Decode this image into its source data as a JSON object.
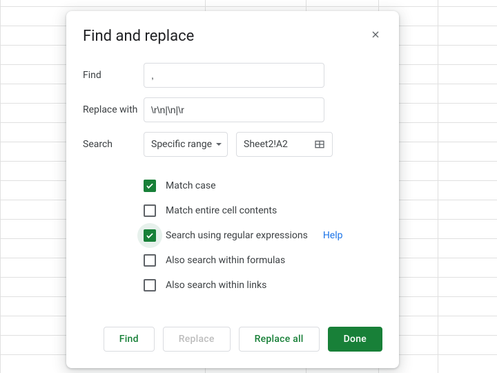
{
  "dialog": {
    "title": "Find and replace",
    "labels": {
      "find": "Find",
      "replace_with": "Replace with",
      "search": "Search"
    },
    "find_value": ",",
    "replace_value": "\\r\\n|\\n|\\r",
    "search_scope": "Specific range",
    "range_value": "Sheet2!A2",
    "checks": {
      "match_case": {
        "label": "Match case",
        "checked": true
      },
      "match_entire": {
        "label": "Match entire cell contents",
        "checked": false
      },
      "regex": {
        "label": "Search using regular expressions",
        "checked": true,
        "help": "Help"
      },
      "formulas": {
        "label": "Also search within formulas",
        "checked": false
      },
      "links": {
        "label": "Also search within links",
        "checked": false
      }
    },
    "buttons": {
      "find": "Find",
      "replace": "Replace",
      "replace_all": "Replace all",
      "done": "Done"
    }
  },
  "colors": {
    "primary": "#188038",
    "link": "#1a73e8"
  }
}
